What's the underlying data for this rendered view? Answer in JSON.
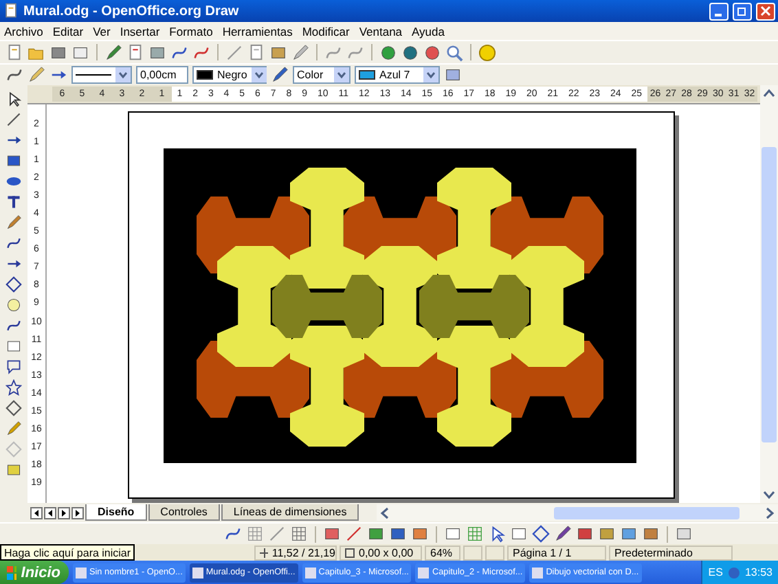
{
  "window": {
    "title": "Mural.odg - OpenOffice.org Draw"
  },
  "menu": [
    "Archivo",
    "Editar",
    "Ver",
    "Insertar",
    "Formato",
    "Herramientas",
    "Modificar",
    "Ventana",
    "Ayuda"
  ],
  "line_toolbar": {
    "line_width": "0,00cm",
    "line_color": {
      "value": "Negro",
      "color": "#000000"
    },
    "area_style": "Color",
    "area_color": {
      "value": "Azul 7",
      "color": "#1ea0e0"
    }
  },
  "ruler": {
    "left_marks": [
      "6",
      "5",
      "4",
      "3",
      "2",
      "1"
    ],
    "page_marks": [
      "1",
      "2",
      "3",
      "4",
      "5",
      "6",
      "7",
      "8",
      "9",
      "10",
      "11",
      "12",
      "13",
      "14",
      "15",
      "16",
      "17",
      "18",
      "19",
      "20",
      "21",
      "22",
      "23",
      "24",
      "25"
    ],
    "right_marks": [
      "26",
      "27",
      "28",
      "29",
      "30",
      "31",
      "32"
    ],
    "vertical_marks": [
      "2",
      "1",
      "1",
      "2",
      "3",
      "4",
      "5",
      "6",
      "7",
      "8",
      "9",
      "10",
      "11",
      "12",
      "13",
      "14",
      "15",
      "16",
      "17",
      "18",
      "19"
    ]
  },
  "tabs": [
    {
      "label": "Diseño",
      "selected": true
    },
    {
      "label": "Controles",
      "selected": false
    },
    {
      "label": "Líneas de dimensiones",
      "selected": false
    }
  ],
  "tooltip": "Haga clic aquí para iniciar",
  "status_bar": {
    "position": "11,52 / 21,19",
    "size": "0,00 x 0,00",
    "zoom": "64%",
    "page": "Página 1 / 1",
    "style": "Predeterminado"
  },
  "taskbar": {
    "start": "Inicio",
    "tasks": [
      {
        "label": "Sin nombre1 - OpenO...",
        "selected": false
      },
      {
        "label": "Mural.odg - OpenOffi...",
        "selected": true
      },
      {
        "label": "Capitulo_3 - Microsof...",
        "selected": false
      },
      {
        "label": "Capitulo_2 - Microsof...",
        "selected": false
      },
      {
        "label": "Dibujo vectorial con D...",
        "selected": false
      }
    ],
    "language": "ES",
    "clock": "13:53"
  }
}
